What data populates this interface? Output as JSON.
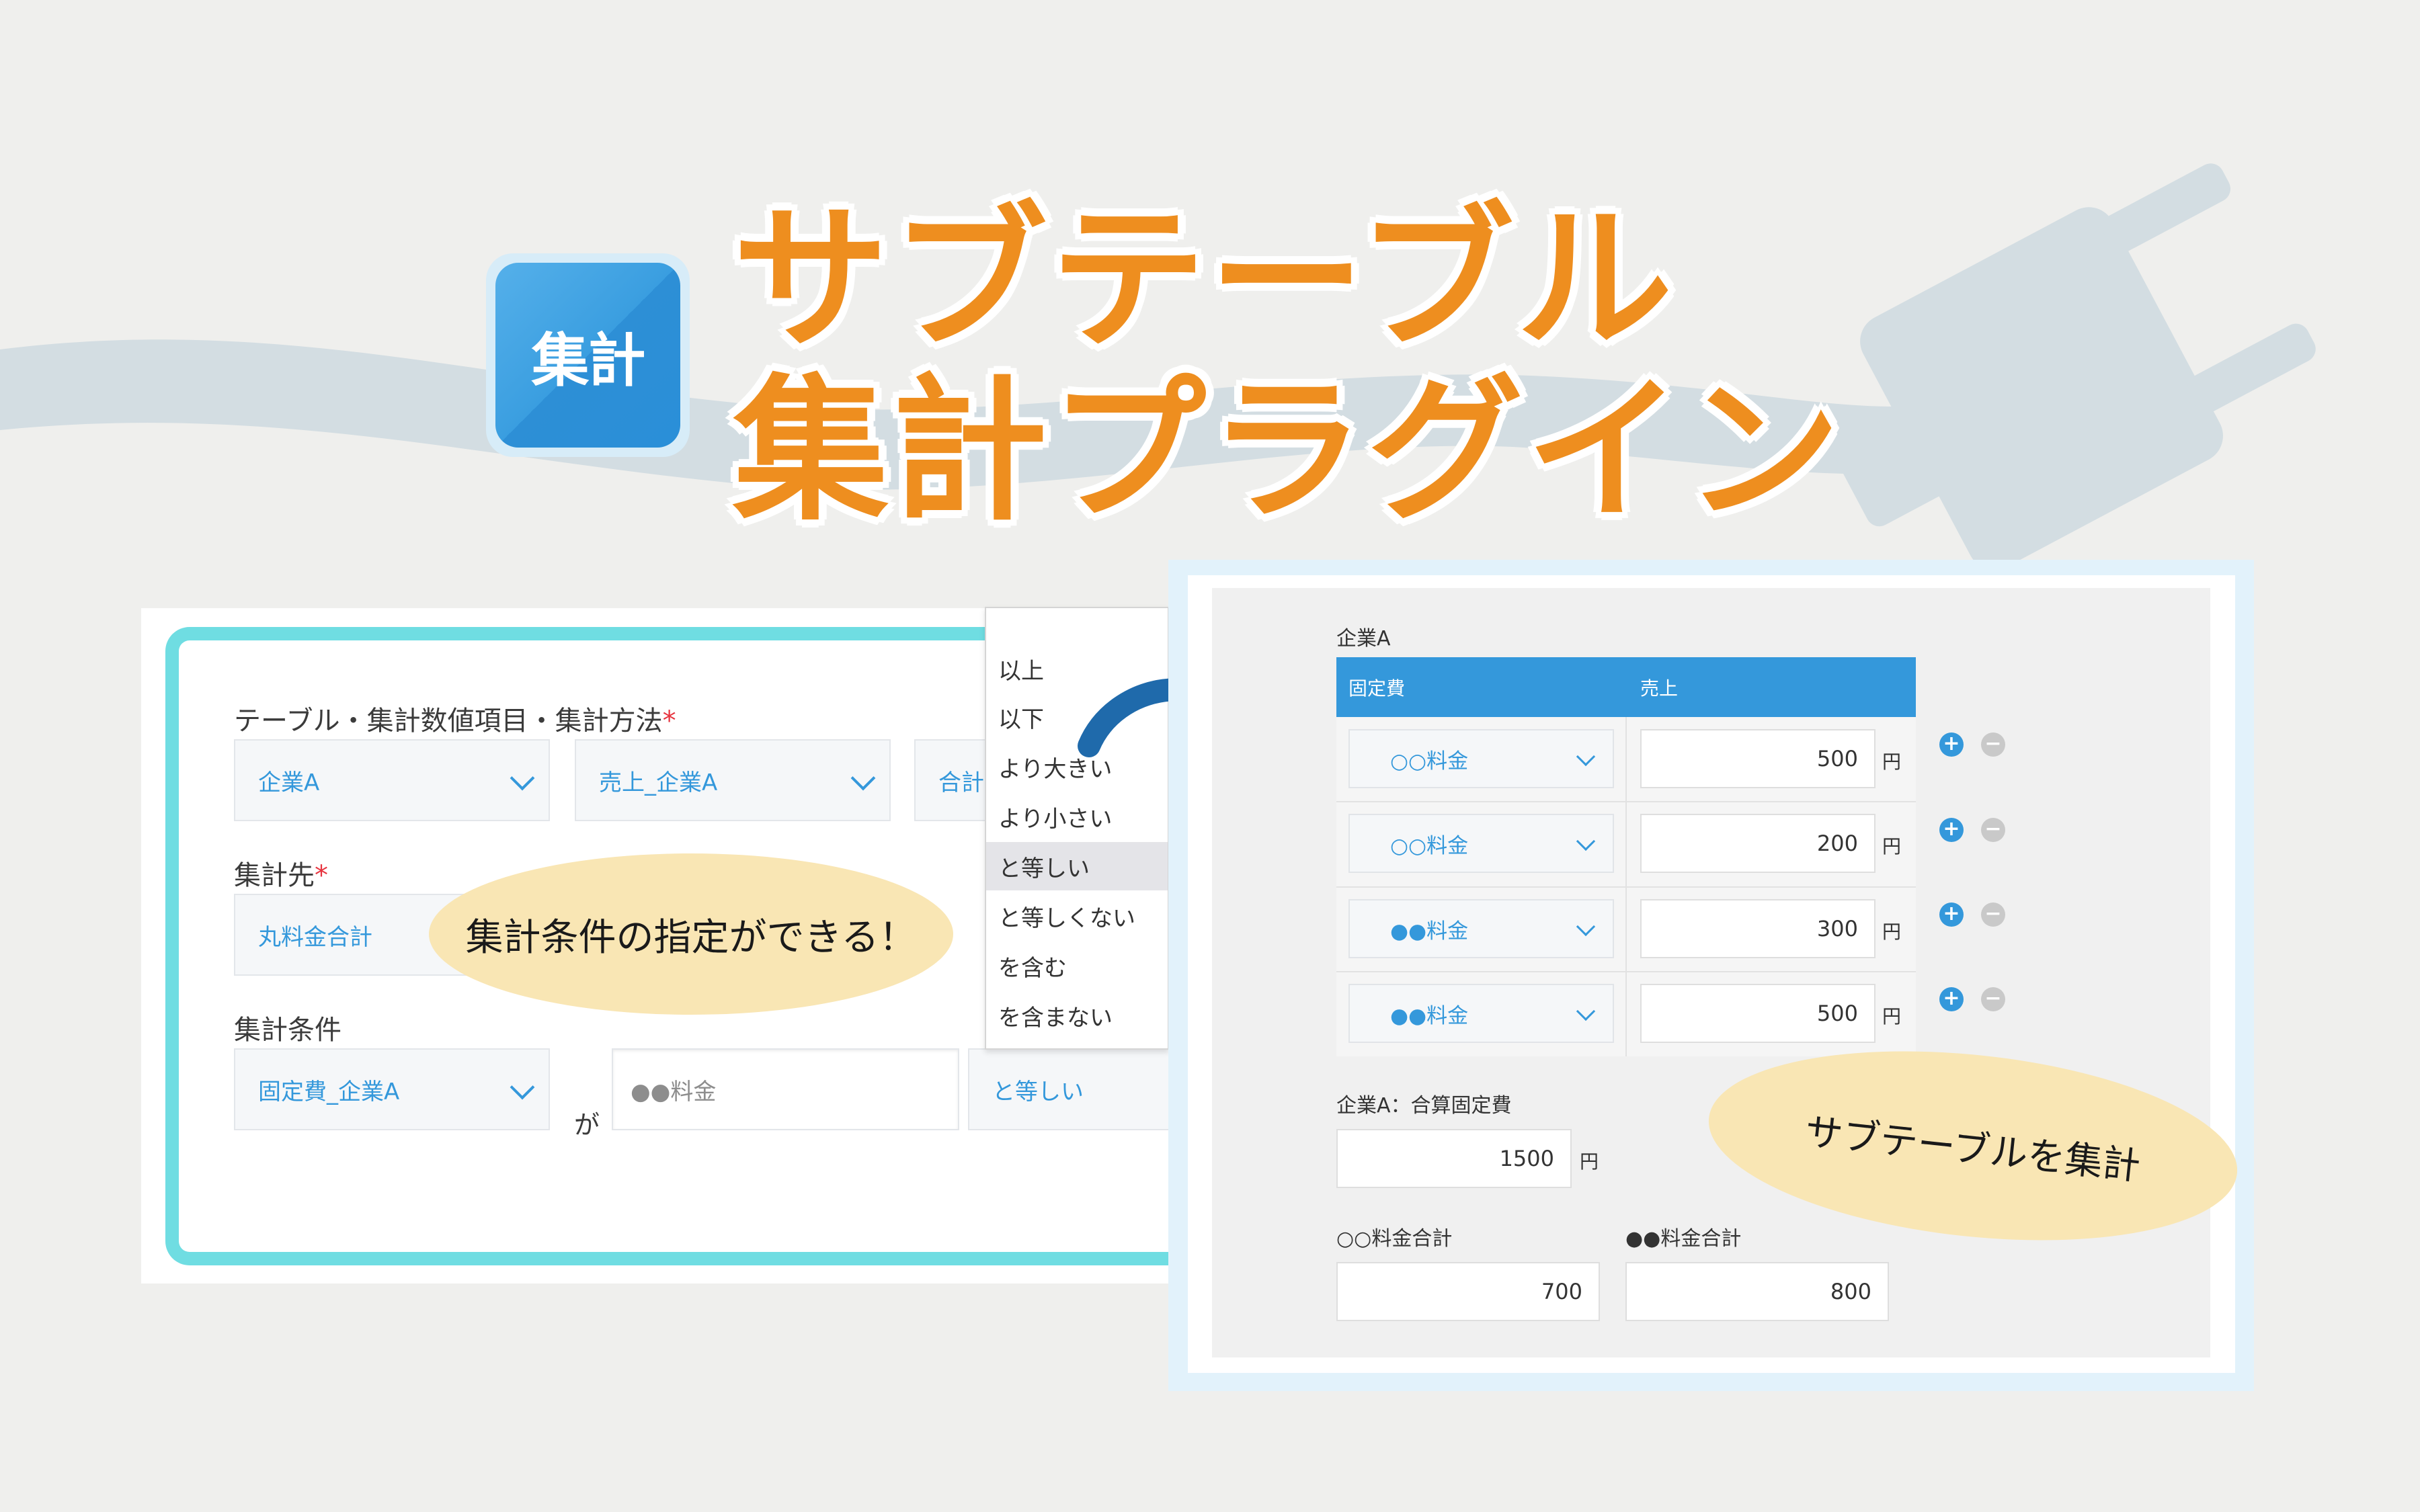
{
  "header": {
    "icon_label": "集計",
    "title_line1": "サブテーブル",
    "title_line2": "集計プラグイン"
  },
  "colors": {
    "title": "#ee8e1f",
    "accent_blue": "#3498db",
    "frame_teal": "#6fdde2",
    "bubble": "#f9e6b4",
    "arrow": "#1f6aab"
  },
  "left_form": {
    "table_label": "テーブル・集計数値項目・集計方法",
    "required_mark": "*",
    "table_select": "企業A",
    "value_select": "売上_企業A",
    "method_select": "合計",
    "target_label": "集計先",
    "target_select": "丸料金合計",
    "condition_label": "集計条件",
    "condition_field_select": "固定費_企業A",
    "ga": "が",
    "condition_value_placeholder": "●●料金",
    "condition_operator_select": "と等しい",
    "bubble_text": "集計条件の指定ができる！"
  },
  "dropdown": {
    "items": [
      "以上",
      "以下",
      "より大きい",
      "より小さい",
      "と等しい",
      "と等しくない",
      "を含む",
      "を含まない"
    ],
    "selected": "と等しい"
  },
  "right_record": {
    "table_title": "企業A",
    "columns": [
      "固定費",
      "売上"
    ],
    "rows": [
      {
        "fee": "○○料金",
        "sales": "500"
      },
      {
        "fee": "○○料金",
        "sales": "200"
      },
      {
        "fee": "●●料金",
        "sales": "300"
      },
      {
        "fee": "●●料金",
        "sales": "500"
      }
    ],
    "unit": "円",
    "plus": "+",
    "minus": "−",
    "sum_fixed_label": "企業A：合算固定費",
    "sum_fixed_value": "1500",
    "total_a_label": "○○料金合計",
    "total_a_value": "700",
    "total_b_label": "●●料金合計",
    "total_b_value": "800",
    "bubble_text": "サブテーブルを集計"
  }
}
